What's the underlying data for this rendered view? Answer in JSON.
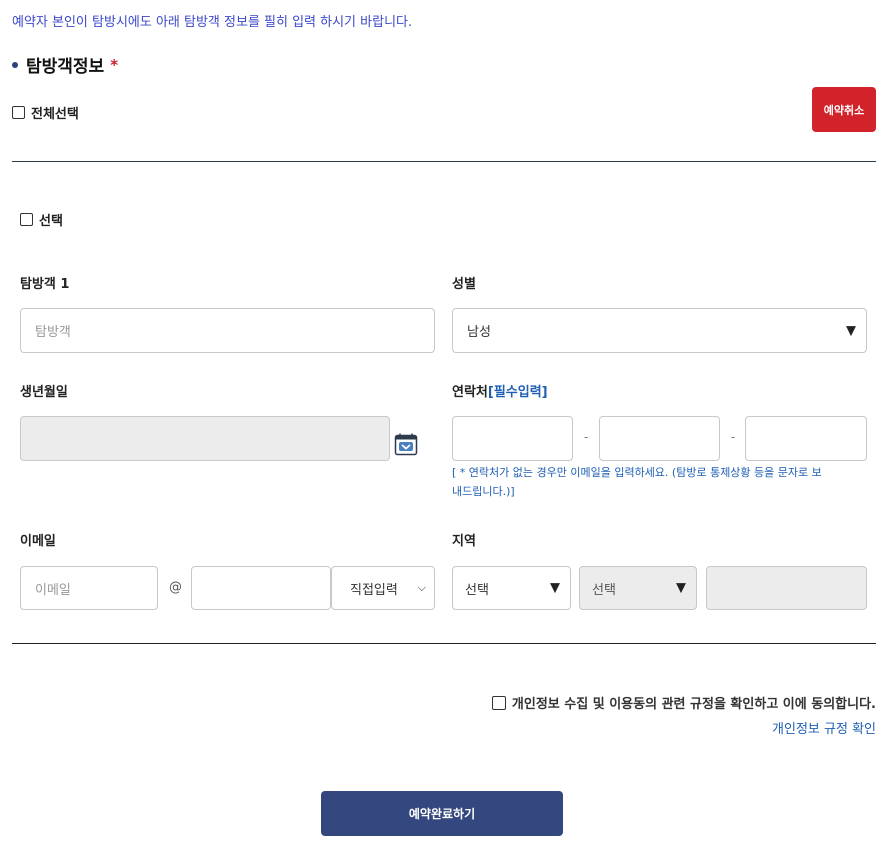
{
  "notice": "예약자 본인이 탐방시에도 아래 탐방객 정보를 필히 입력 하시기 바랍니다.",
  "section": {
    "title": "탐방객정보",
    "required_mark": "*"
  },
  "select_all_label": "전체선택",
  "cancel_button": "예약취소",
  "visitor": {
    "select_label": "선택",
    "name_label": "탐방객 1",
    "name_placeholder": "탐방객",
    "gender_label": "성별",
    "gender_value": "남성",
    "birth_label": "생년월일",
    "contact_label": "연락처",
    "contact_required": "[필수입력]",
    "contact_separator": "-",
    "contact_hint": "[ * 연락처가 없는 경우만 이메일을 입력하세요. (탐방로 통제상황 등을 문자로 보내드립니다.)]",
    "email_label": "이메일",
    "email_placeholder": "이메일",
    "email_at": "@",
    "email_domain_select": "직접입력",
    "region_label": "지역",
    "region_select_1": "선택",
    "region_select_2": "선택"
  },
  "privacy": {
    "agree_text": "개인정보 수집 및 이용동의 관련 규정을 확인하고 이에 동의합니다.",
    "link_text": "개인정보 규정 확인"
  },
  "submit_button": "예약완료하기",
  "colors": {
    "accent_red": "#d2232a",
    "submit_navy": "#34477e",
    "link_blue": "#1e5fb4",
    "notice_blue": "#3a48c8"
  },
  "icons": {
    "calendar": "calendar-icon",
    "dropdown": "caret-down-icon"
  }
}
